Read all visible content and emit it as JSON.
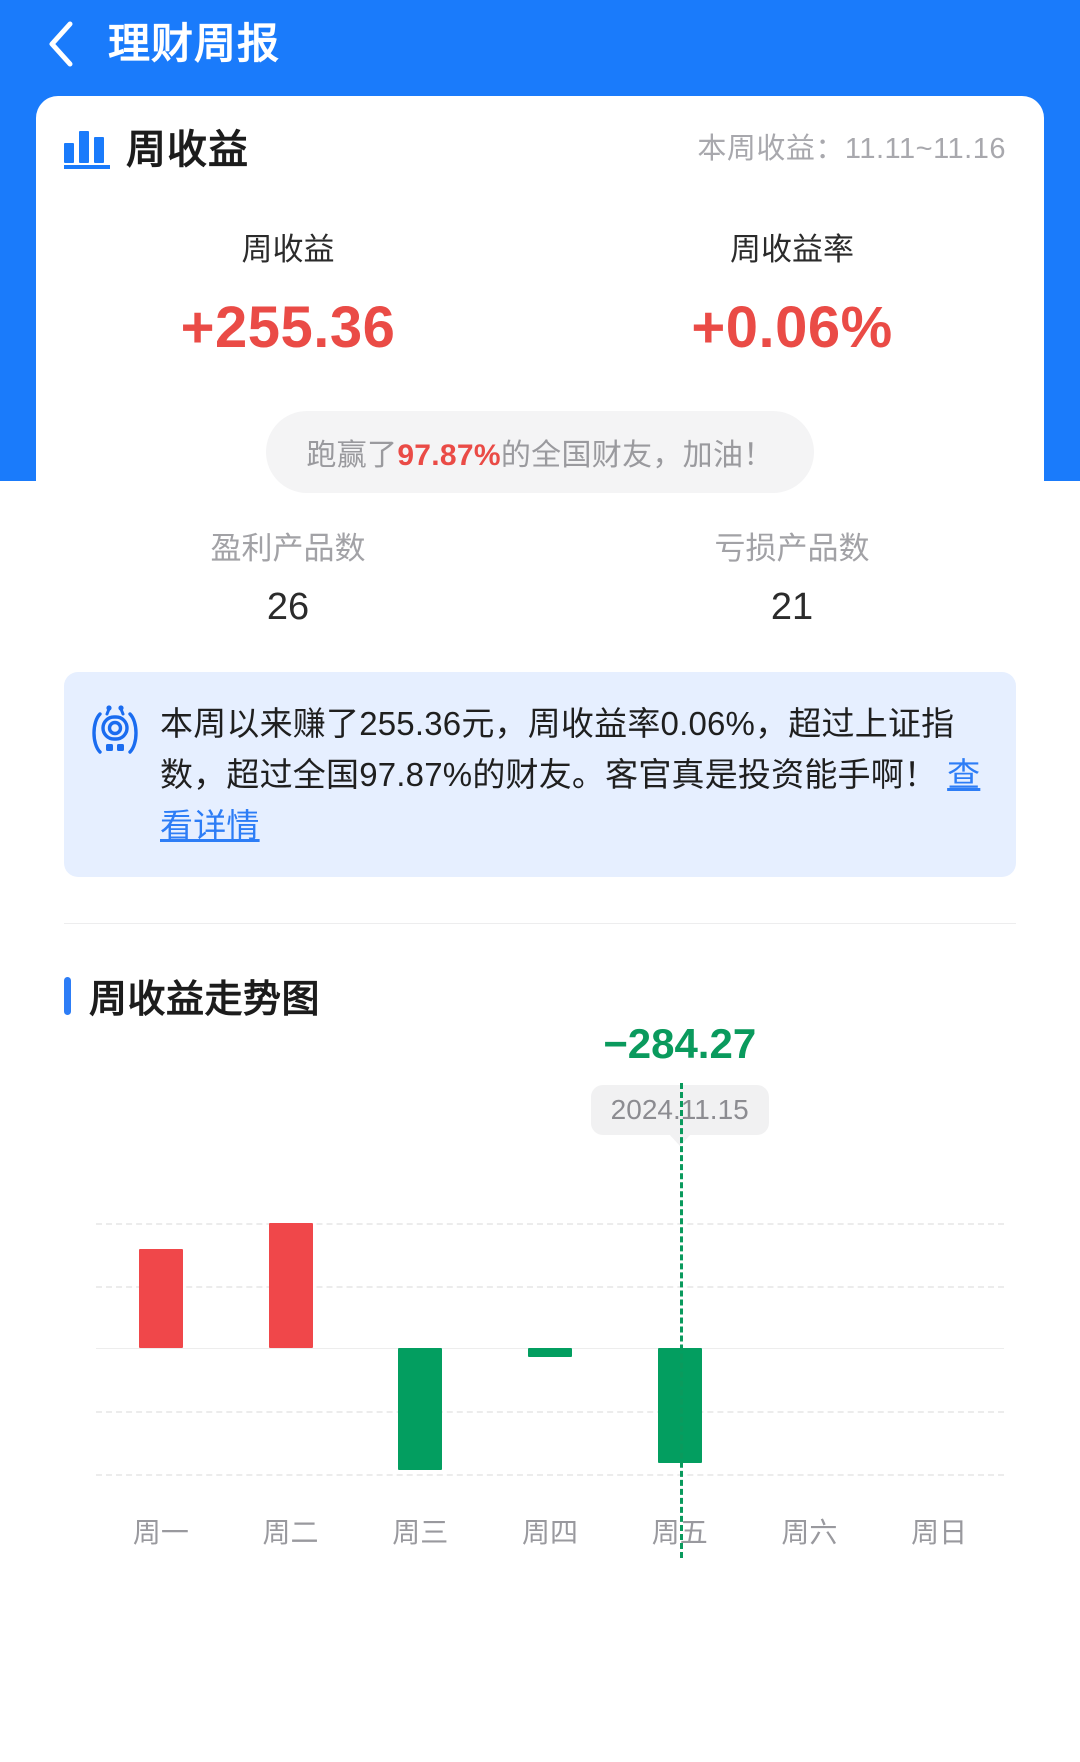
{
  "nav": {
    "back_icon": "chevron-left-icon",
    "title": "理财周报"
  },
  "card": {
    "icon": "bar-chart-icon",
    "title": "周收益",
    "range_label": "本周收益：11.11~11.16"
  },
  "summary": [
    {
      "label": "周收益",
      "value": "+255.36"
    },
    {
      "label": "周收益率",
      "value": "+0.06%"
    }
  ],
  "pill": {
    "prefix": "跑赢了",
    "percent": "97.87%",
    "suffix": "的全国财友，加油！"
  },
  "counts": [
    {
      "label": "盈利产品数",
      "value": "26"
    },
    {
      "label": "亏损产品数",
      "value": "21"
    }
  ],
  "infobox": {
    "icon": "robot-assistant-icon",
    "text": "本周以来赚了255.36元，周收益率0.06%，超过上证指数，超过全国97.87%的财友。客官真是投资能手啊！",
    "link": "查看详情"
  },
  "trend": {
    "title": "周收益走势图"
  },
  "colors": {
    "brand_blue": "#1a7bfb",
    "positive_red": "#ea4b46",
    "negative_green": "#0a9a5d",
    "info_bg": "#e6efff",
    "link_blue": "#2d7df6"
  },
  "chart_data": {
    "type": "bar",
    "title": "周收益走势图",
    "xlabel": "",
    "ylabel": "",
    "categories": [
      "周一",
      "周二",
      "周三",
      "周四",
      "周五",
      "周六",
      "周日"
    ],
    "values": [
      245.0,
      310.0,
      -300.0,
      -22.0,
      -284.27,
      0,
      0
    ],
    "ylim": [
      -420,
      420
    ],
    "grid": true,
    "gridlines": [
      310,
      155,
      0,
      -155,
      -310
    ],
    "legend": "none",
    "selected": {
      "category": "周五",
      "value_label": "−284.27",
      "date_label": "2024.11.15"
    },
    "series_colors": {
      "positive": "#f0474a",
      "negative": "#039e60"
    }
  }
}
